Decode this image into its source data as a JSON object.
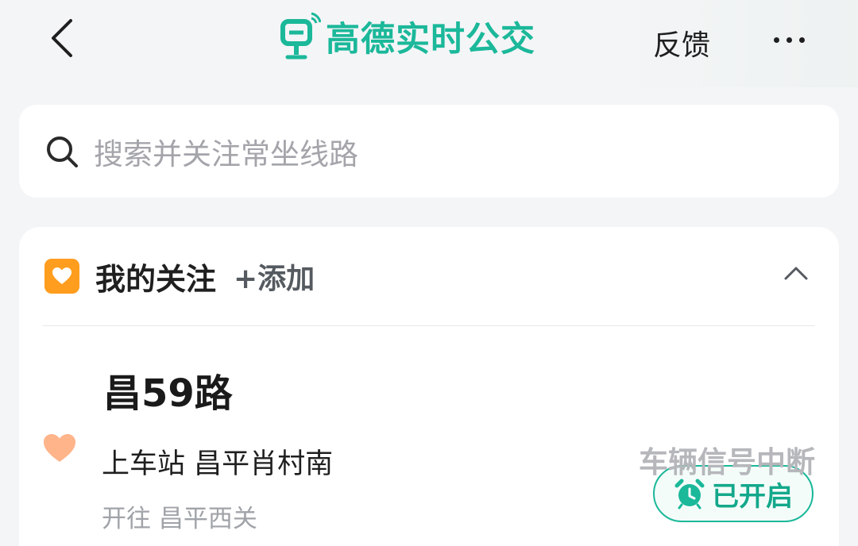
{
  "header": {
    "back_icon": "chevron-left-icon",
    "logo_icon": "bus-stop-signal-icon",
    "title": "高德实时公交",
    "feedback_label": "反馈",
    "more_icon": "more-dots-icon"
  },
  "search": {
    "icon": "search-icon",
    "placeholder": "搜索并关注常坐线路"
  },
  "favorites": {
    "icon": "heart-square-icon",
    "title": "我的关注",
    "add_label": "+添加",
    "collapse_icon": "chevron-up-icon",
    "routes": [
      {
        "name": "昌59路",
        "heart_icon": "heart-icon",
        "boarding": "上车站 昌平肖村南",
        "destination": "开往 昌平西关",
        "alarm_label": "已开启",
        "alarm_icon": "alarm-clock-icon",
        "status": "车辆信号中断"
      }
    ]
  },
  "colors": {
    "brand": "#1bb89a",
    "accent_orange": "#ff9d1e",
    "heart": "#ffb48a"
  }
}
